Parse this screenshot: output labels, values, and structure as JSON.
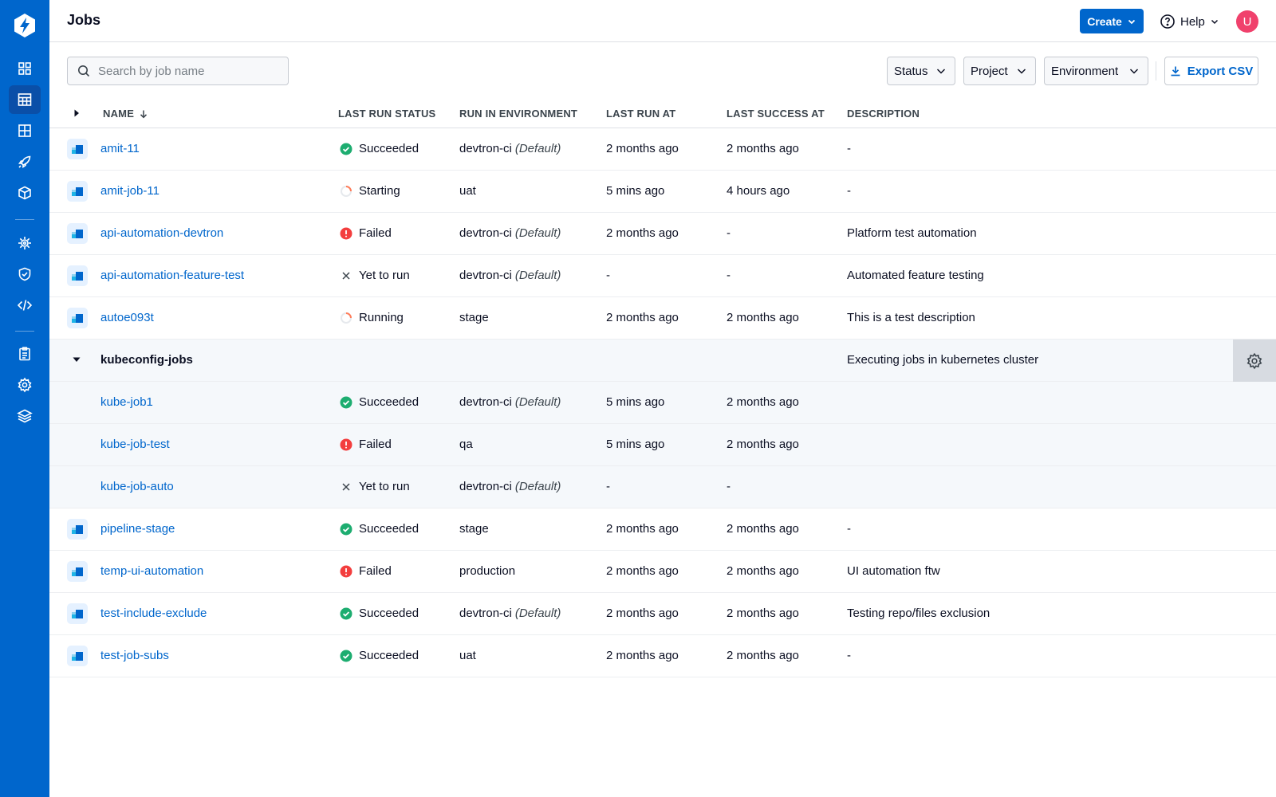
{
  "header": {
    "title": "Jobs",
    "create_label": "Create",
    "help_label": "Help",
    "avatar_initial": "U"
  },
  "toolbar": {
    "search_placeholder": "Search by job name",
    "filters": [
      "Status",
      "Project",
      "Environment"
    ],
    "export_label": "Export CSV"
  },
  "table": {
    "columns": {
      "name": "NAME",
      "status": "LAST RUN STATUS",
      "env": "RUN IN ENVIRONMENT",
      "last_run": "LAST RUN AT",
      "last_success": "LAST SUCCESS AT",
      "description": "DESCRIPTION"
    },
    "default_tag": "(Default)",
    "rows": [
      {
        "name": "amit-11",
        "status": "Succeeded",
        "status_icon": "success",
        "env": "devtron-ci",
        "env_default": true,
        "last_run": "2 months ago",
        "last_success": "2 months ago",
        "description": "-"
      },
      {
        "name": "amit-job-11",
        "status": "Starting",
        "status_icon": "progress",
        "env": "uat",
        "env_default": false,
        "last_run": "5 mins ago",
        "last_success": "4 hours ago",
        "description": "-"
      },
      {
        "name": "api-automation-devtron",
        "status": "Failed",
        "status_icon": "failed",
        "env": "devtron-ci",
        "env_default": true,
        "last_run": "2 months ago",
        "last_success": "-",
        "description": "Platform test automation"
      },
      {
        "name": "api-automation-feature-test",
        "status": "Yet to run",
        "status_icon": "cross",
        "env": "devtron-ci",
        "env_default": true,
        "last_run": "-",
        "last_success": "-",
        "description": "Automated feature testing"
      },
      {
        "name": "autoe093t",
        "status": "Running",
        "status_icon": "progress",
        "env": "stage",
        "env_default": false,
        "last_run": "2 months ago",
        "last_success": "2 months ago",
        "description": "This is a test description"
      }
    ],
    "group": {
      "name": "kubeconfig-jobs",
      "description": "Executing jobs in kubernetes cluster",
      "children": [
        {
          "name": "kube-job1",
          "status": "Succeeded",
          "status_icon": "success",
          "env": "devtron-ci",
          "env_default": true,
          "last_run": "5 mins ago",
          "last_success": "2 months ago"
        },
        {
          "name": "kube-job-test",
          "status": "Failed",
          "status_icon": "failed",
          "env": "qa",
          "env_default": false,
          "last_run": "5 mins ago",
          "last_success": "2 months ago"
        },
        {
          "name": "kube-job-auto",
          "status": "Yet to run",
          "status_icon": "cross",
          "env": "devtron-ci",
          "env_default": true,
          "last_run": "-",
          "last_success": "-"
        }
      ]
    },
    "rows_after": [
      {
        "name": "pipeline-stage",
        "status": "Succeeded",
        "status_icon": "success",
        "env": "stage",
        "env_default": false,
        "last_run": "2 months ago",
        "last_success": "2 months ago",
        "description": "-"
      },
      {
        "name": "temp-ui-automation",
        "status": "Failed",
        "status_icon": "failed",
        "env": "production",
        "env_default": false,
        "last_run": "2 months ago",
        "last_success": "2 months ago",
        "description": "UI automation ftw"
      },
      {
        "name": "test-include-exclude",
        "status": "Succeeded",
        "status_icon": "success",
        "env": "devtron-ci",
        "env_default": true,
        "last_run": "2 months ago",
        "last_success": "2 months ago",
        "description": "Testing repo/files exclusion"
      },
      {
        "name": "test-job-subs",
        "status": "Succeeded",
        "status_icon": "success",
        "env": "uat",
        "env_default": false,
        "last_run": "2 months ago",
        "last_success": "2 months ago",
        "description": "-"
      }
    ]
  },
  "sidebar": {
    "items": [
      "overview-icon",
      "jobs-icon",
      "apps-grid-icon",
      "deploy-rocket-icon",
      "cube-icon",
      "bug-icon",
      "shield-icon",
      "code-icon",
      "clipboard-icon",
      "settings-gear-icon",
      "layers-icon"
    ]
  },
  "colors": {
    "brand": "#0066cc",
    "success": "#1dad70",
    "failed": "#f33e3e",
    "progress": "#ff7e5b"
  }
}
